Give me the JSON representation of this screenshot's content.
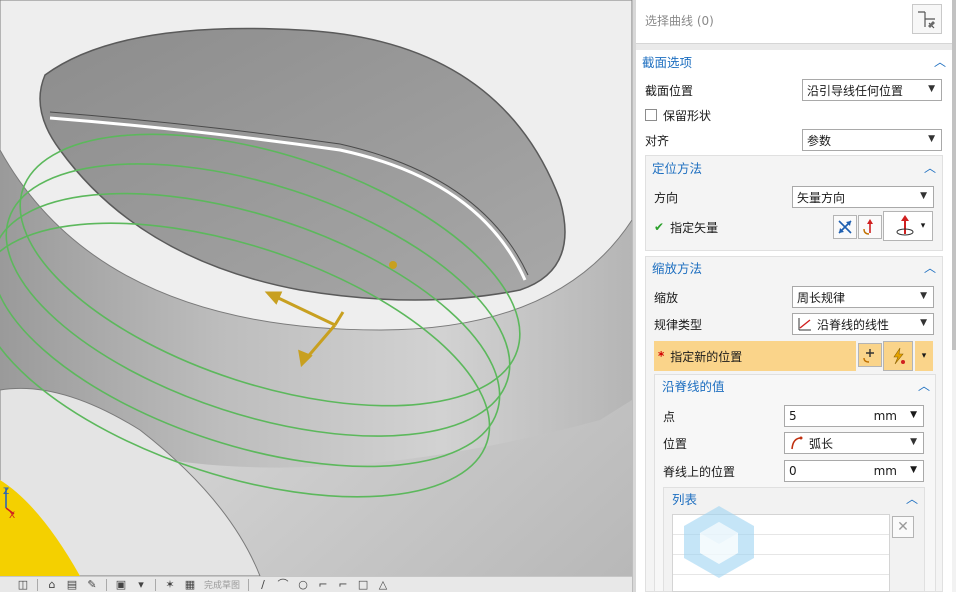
{
  "panel": {
    "select_curve": {
      "label": "选择曲线 (0)",
      "icon": "select-curve-icon"
    },
    "section_options": {
      "title": "截面选项",
      "section_position": {
        "label": "截面位置",
        "value": "沿引导线任何位置"
      },
      "keep_shape": {
        "label": "保留形状",
        "checked": false
      },
      "alignment": {
        "label": "对齐",
        "value": "参数"
      }
    },
    "orientation": {
      "title": "定位方法",
      "direction": {
        "label": "方向",
        "value": "矢量方向"
      },
      "specify_vector": {
        "label": "指定矢量",
        "status": "done"
      }
    },
    "scaling": {
      "title": "缩放方法",
      "scale": {
        "label": "缩放",
        "value": "周长规律"
      },
      "law_type": {
        "label": "规律类型",
        "value": "沿脊线的线性"
      },
      "specify_new_location": {
        "label": "指定新的位置",
        "required_mark": "*"
      },
      "spine_values": {
        "title": "沿脊线的值",
        "point": {
          "label": "点",
          "value": "5",
          "unit": "mm"
        },
        "location": {
          "label": "位置",
          "value": "弧长"
        },
        "spine_position": {
          "label": "脊线上的位置",
          "value": "0",
          "unit": "mm"
        },
        "list": {
          "title": "列表"
        }
      }
    }
  },
  "bottom_toolbar": {
    "text": "完成草图"
  },
  "colors": {
    "accent": "#1e6fc0",
    "highlight": "#fad48a",
    "curve": "#5cb85c",
    "required": "#d20000",
    "check": "#2aa02a"
  }
}
